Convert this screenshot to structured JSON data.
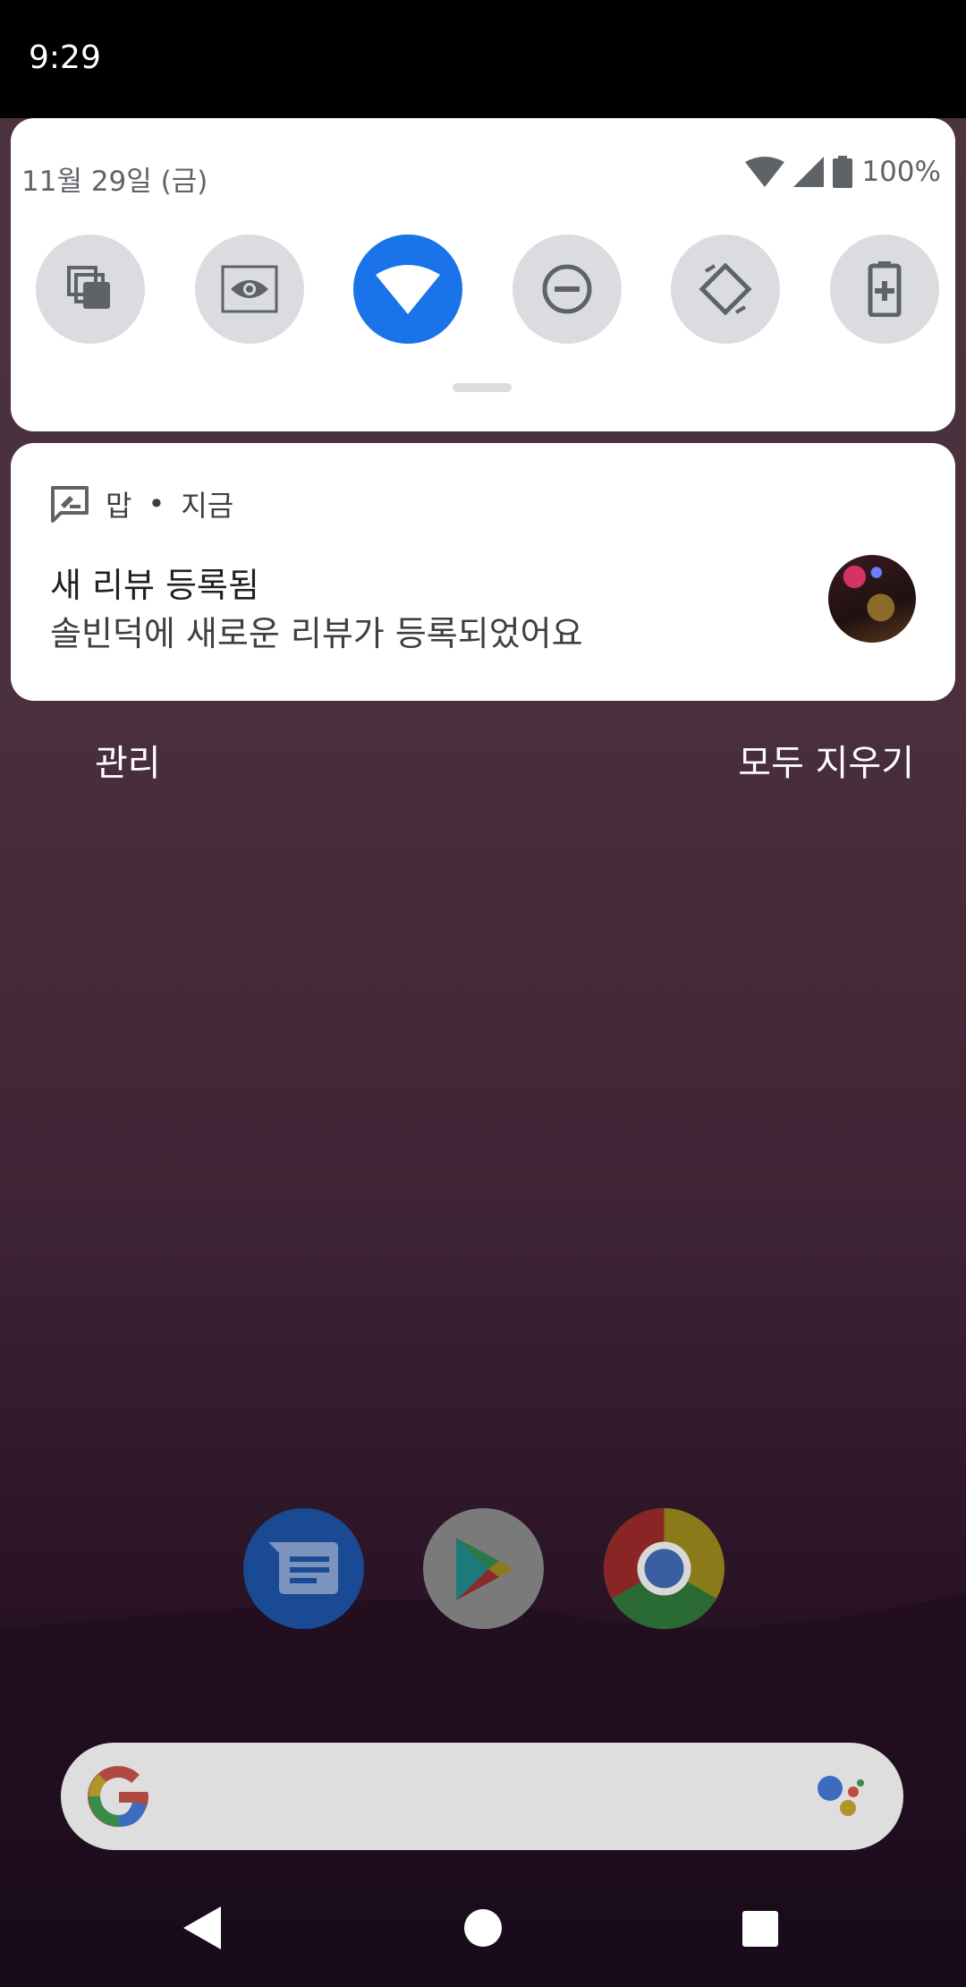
{
  "status_bar": {
    "time": "9:29"
  },
  "quick_settings": {
    "date": "11월 29일 (금)",
    "battery": "100%",
    "tiles": [
      {
        "icon": "multi-window-icon"
      },
      {
        "icon": "eye-screen-icon"
      },
      {
        "icon": "wifi-icon",
        "active": true
      },
      {
        "icon": "do-not-disturb-icon"
      },
      {
        "icon": "auto-rotate-icon"
      },
      {
        "icon": "battery-saver-icon"
      }
    ]
  },
  "notification": {
    "app": "맙",
    "separator": "•",
    "time": "지금",
    "title": "새 리뷰 등록됨",
    "text": "솔빈덕에 새로운 리뷰가 등록되었어요"
  },
  "actions": {
    "manage": "관리",
    "clear_all": "모두 지우기"
  },
  "dock": [
    {
      "icon": "messages-app-icon"
    },
    {
      "icon": "play-store-icon"
    },
    {
      "icon": "chrome-icon"
    }
  ],
  "colors": {
    "accent": "#1a73e8",
    "tile_bg": "#dadce0"
  }
}
